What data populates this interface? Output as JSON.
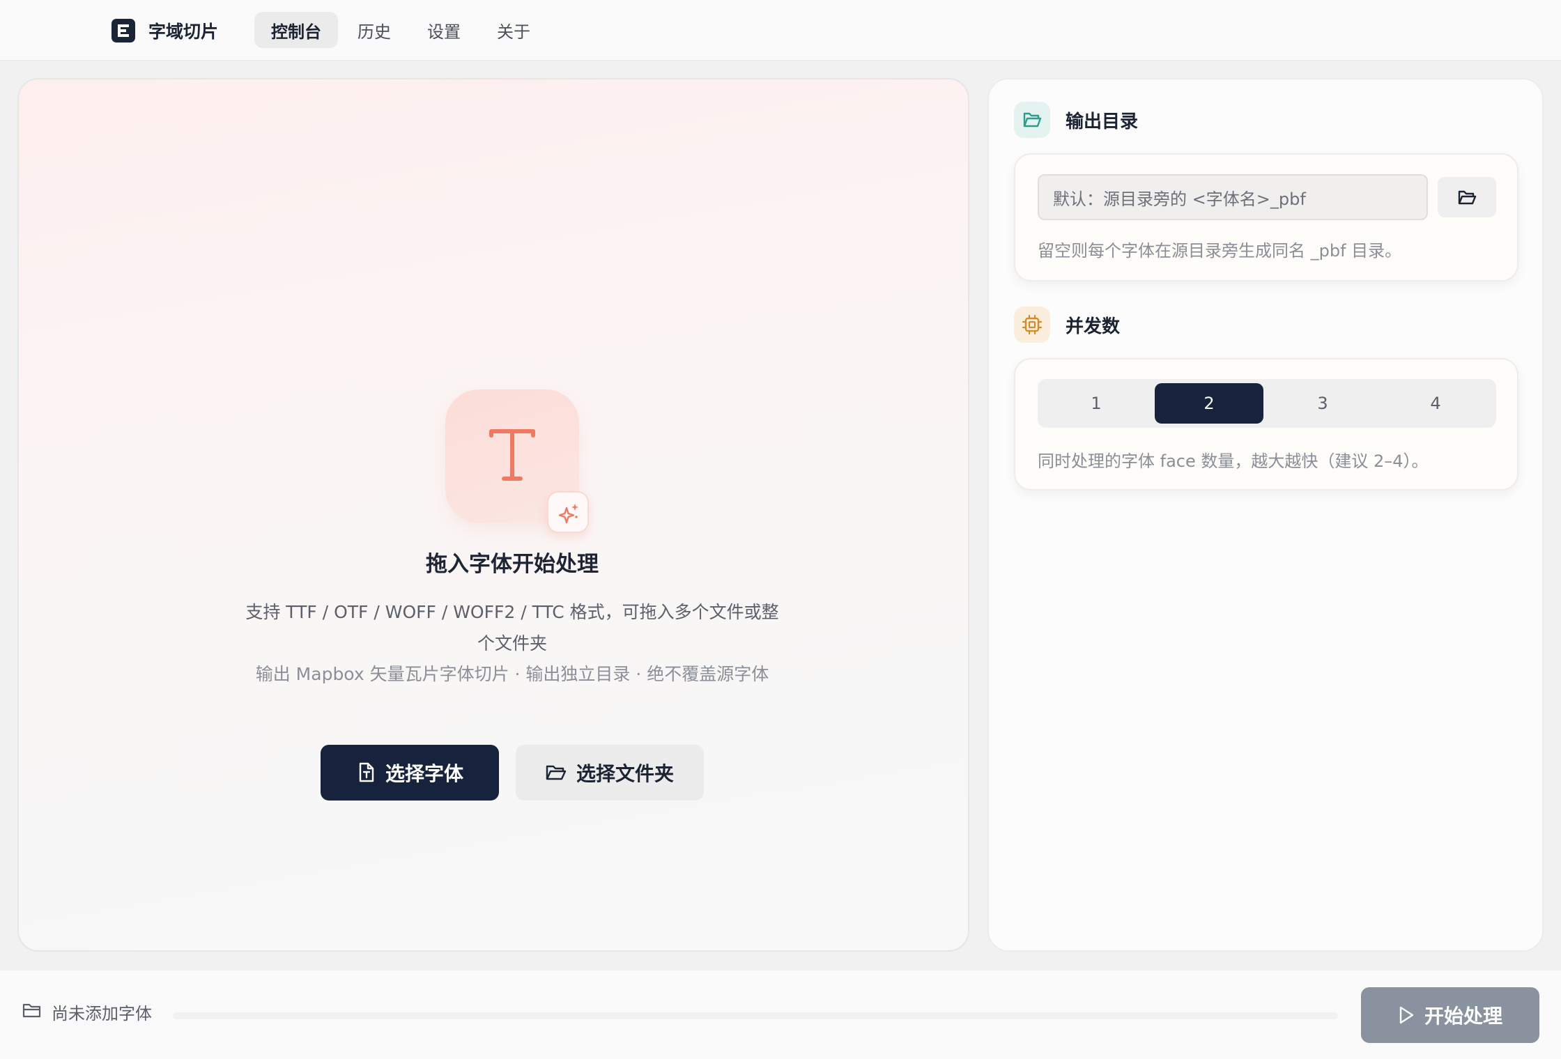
{
  "app": {
    "name": "字域切片",
    "nav": [
      {
        "label": "控制台",
        "active": true
      },
      {
        "label": "历史",
        "active": false
      },
      {
        "label": "设置",
        "active": false
      },
      {
        "label": "关于",
        "active": false
      }
    ]
  },
  "dropzone": {
    "icon": "text-font-icon",
    "badge_icon": "sparkles-icon",
    "title": "拖入字体开始处理",
    "description": "支持 TTF / OTF / WOFF / WOFF2 / TTC 格式，可拖入多个文件或整个文件夹",
    "note": "输出 Mapbox 矢量瓦片字体切片 · 输出独立目录 · 绝不覆盖源字体",
    "select_fonts_label": "选择字体",
    "select_folder_label": "选择文件夹"
  },
  "output_dir": {
    "title": "输出目录",
    "icon": "folder-open-icon",
    "value": "",
    "placeholder": "默认：源目录旁的 <字体名>_pbf",
    "hint": "留空则每个字体在源目录旁生成同名 _pbf 目录。"
  },
  "concurrency": {
    "title": "并发数",
    "icon": "cpu-chip-icon",
    "options": [
      "1",
      "2",
      "3",
      "4"
    ],
    "selected": "2",
    "hint": "同时处理的字体 face 数量，越大越快（建议 2–4）。"
  },
  "footer": {
    "status_icon": "folder-icon",
    "status": "尚未添加字体",
    "progress": 0,
    "start_label": "开始处理",
    "start_icon": "play-icon"
  },
  "colors": {
    "primary": "#17233c",
    "accent_coral": "#ee7a62",
    "teal": "#2a9d8f",
    "amber": "#d38b2b",
    "disabled": "#8a929f"
  }
}
